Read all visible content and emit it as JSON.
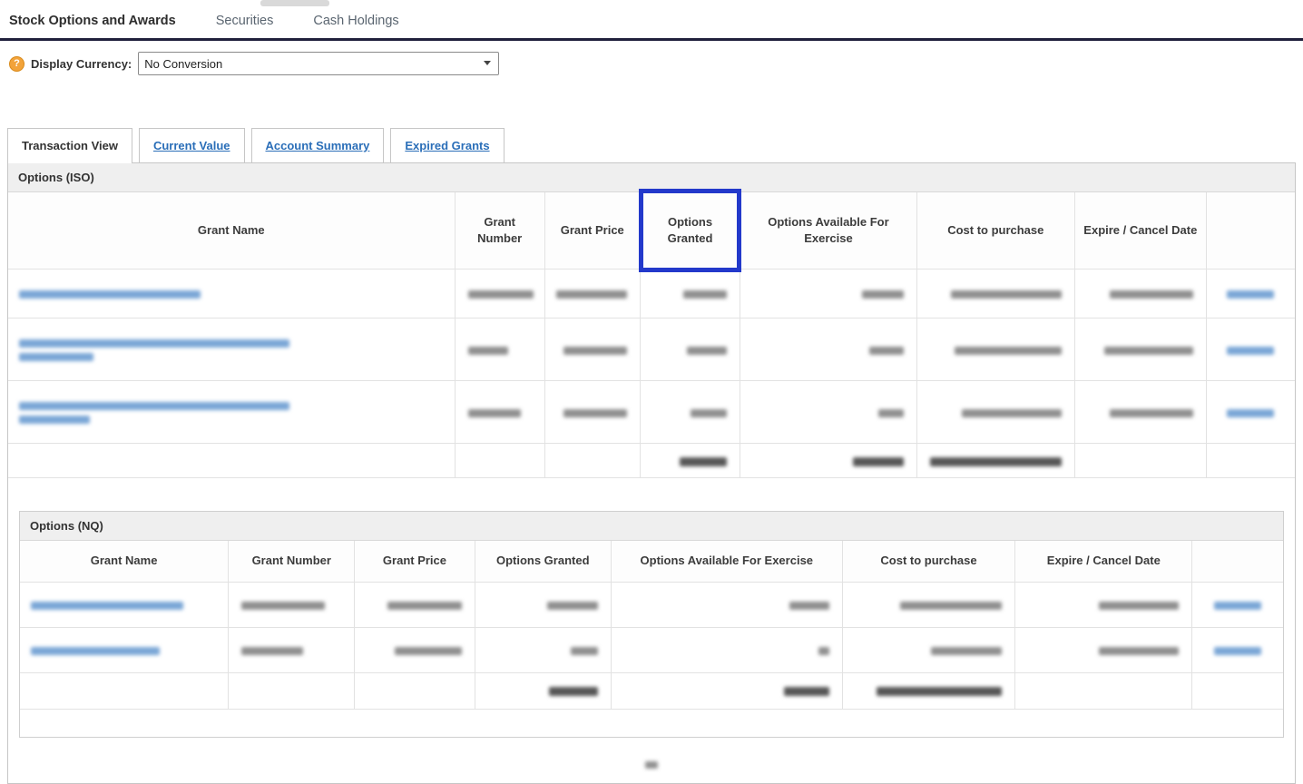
{
  "top_nav": {
    "tabs": [
      {
        "label": "Stock Options and Awards",
        "active": true
      },
      {
        "label": "Securities",
        "active": false
      },
      {
        "label": "Cash Holdings",
        "active": false
      }
    ]
  },
  "currency_bar": {
    "help_glyph": "?",
    "label": "Display Currency:",
    "selected_option": "No Conversion"
  },
  "view_tabs": [
    {
      "label": "Transaction View",
      "active": true
    },
    {
      "label": "Current Value",
      "active": false
    },
    {
      "label": "Account Summary",
      "active": false
    },
    {
      "label": "Expired Grants",
      "active": false
    }
  ],
  "iso_table": {
    "title": "Options (ISO)",
    "columns": [
      "Grant Name",
      "Grant Number",
      "Grant Price",
      "Options Granted",
      "Options Available For Exercise",
      "Cost to purchase",
      "Expire / Cancel Date",
      ""
    ],
    "highlighted_column": "Options Granted",
    "highlight_index": 3,
    "highlight_color": "#2339cb",
    "redacted": true,
    "rows": [
      {
        "name": [
          200
        ],
        "number": 72,
        "price": 78,
        "granted": 48,
        "available": 46,
        "cost": 122,
        "date": 92,
        "action": 52
      },
      {
        "name": [
          298,
          82
        ],
        "number": 44,
        "price": 70,
        "granted": 44,
        "available": 38,
        "cost": 118,
        "date": 98,
        "action": 52
      },
      {
        "name": [
          298,
          78
        ],
        "number": 58,
        "price": 70,
        "granted": 40,
        "available": 28,
        "cost": 110,
        "date": 92,
        "action": 52
      }
    ],
    "totals": {
      "granted": 52,
      "available": 56,
      "cost": 150
    }
  },
  "nq_table": {
    "title": "Options (NQ)",
    "columns": [
      "Grant Name",
      "Grant Number",
      "Grant Price",
      "Options Granted",
      "Options Available For Exercise",
      "Cost to purchase",
      "Expire / Cancel Date",
      ""
    ],
    "redacted": true,
    "rows": [
      {
        "name": [
          168
        ],
        "number": 92,
        "price": 82,
        "granted": 56,
        "available": 44,
        "cost": 112,
        "date": 88,
        "action": 52
      },
      {
        "name": [
          142
        ],
        "number": 68,
        "price": 74,
        "granted": 30,
        "available": 12,
        "cost": 78,
        "date": 88,
        "action": 52
      }
    ],
    "totals": {
      "granted": 54,
      "available": 50,
      "cost": 138
    }
  },
  "footer": {
    "pagination_redacted": true
  }
}
